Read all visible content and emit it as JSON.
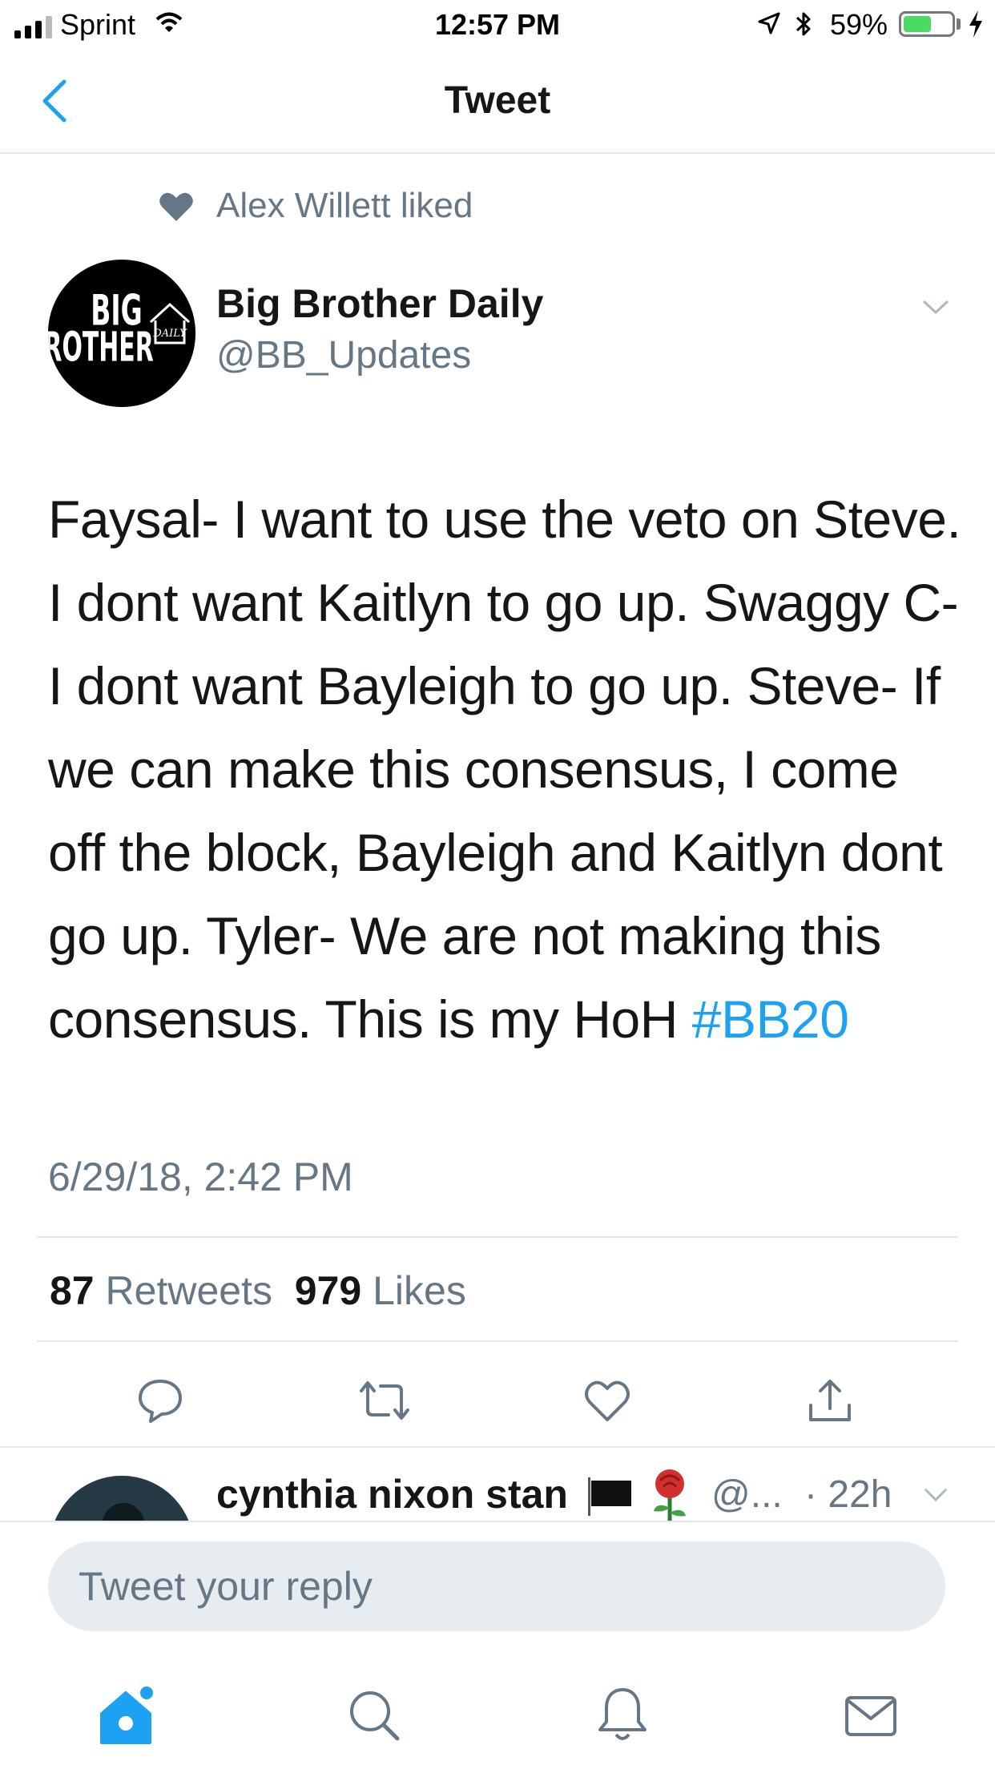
{
  "status_bar": {
    "carrier": "Sprint",
    "time": "12:57 PM",
    "battery_percent": "59%",
    "battery_level": 0.59
  },
  "nav": {
    "title": "Tweet",
    "back_icon": "chevron-left-icon"
  },
  "social_context": {
    "text": "Alex Willett liked",
    "icon": "heart-filled-icon"
  },
  "tweet": {
    "author_name": "Big Brother Daily",
    "author_handle": "@BB_Updates",
    "avatar_logo": {
      "line1": "BIG",
      "line2": "BROTHER",
      "small": "DAILY"
    },
    "text": "Faysal- I want to use the veto on Steve. I dont want Kaitlyn to go up. Swaggy C- I dont want Bayleigh to go up. Steve- If we can make this consensus, I come off the block, Bayleigh and Kaitlyn dont go up. Tyler- We are not making this consensus. This is my HoH",
    "hashtag": "#BB20",
    "timestamp": "6/29/18, 2:42 PM",
    "retweets_count": "87",
    "retweets_label": "Retweets",
    "likes_count": "979",
    "likes_label": "Likes"
  },
  "actions": [
    "reply-icon",
    "retweet-icon",
    "like-icon",
    "share-icon"
  ],
  "reply_preview": {
    "name": "cynthia nixon stan",
    "handle": "@...",
    "time": "· 22h"
  },
  "reply_bar": {
    "placeholder": "Tweet your reply"
  },
  "tab_bar": [
    "home-icon",
    "search-icon",
    "notifications-icon",
    "messages-icon"
  ],
  "colors": {
    "accent": "#1da1f2",
    "secondary_text": "#657786",
    "divider": "#e1e8ed",
    "input_bg": "#e6ecf0"
  }
}
